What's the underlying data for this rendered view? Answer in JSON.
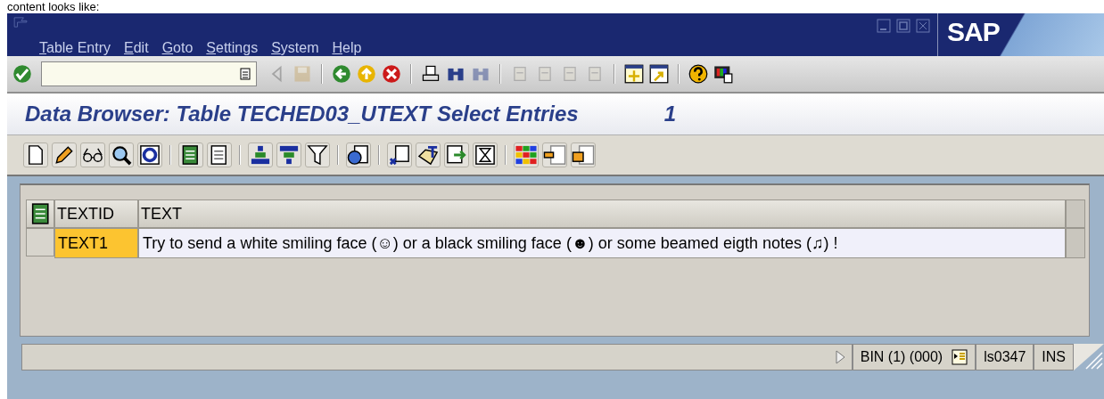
{
  "caption": "content looks like:",
  "window": {
    "logo": "SAP"
  },
  "menu": [
    {
      "label": "Table Entry"
    },
    {
      "label": "Edit"
    },
    {
      "label": "Goto"
    },
    {
      "label": "Settings"
    },
    {
      "label": "System"
    },
    {
      "label": "Help"
    }
  ],
  "system_toolbar": {
    "buttons": [
      {
        "kind": "enter",
        "disabled": false
      },
      {
        "kind": "field"
      },
      {
        "kind": "triangle",
        "disabled": true
      },
      {
        "kind": "save",
        "disabled": true
      },
      {
        "kind": "sep"
      },
      {
        "kind": "back",
        "disabled": false
      },
      {
        "kind": "exit",
        "disabled": false
      },
      {
        "kind": "cancel",
        "disabled": false
      },
      {
        "kind": "sep"
      },
      {
        "kind": "print",
        "disabled": false
      },
      {
        "kind": "find",
        "disabled": false
      },
      {
        "kind": "find",
        "disabled": true
      },
      {
        "kind": "sep"
      },
      {
        "kind": "page",
        "disabled": true
      },
      {
        "kind": "page",
        "disabled": true
      },
      {
        "kind": "page",
        "disabled": true
      },
      {
        "kind": "page",
        "disabled": true
      },
      {
        "kind": "sep"
      },
      {
        "kind": "session",
        "disabled": false
      },
      {
        "kind": "shortcut",
        "disabled": false
      },
      {
        "kind": "sep"
      },
      {
        "kind": "help",
        "disabled": false
      },
      {
        "kind": "layout",
        "disabled": false
      }
    ]
  },
  "screen_title": {
    "text": "Data Browser: Table TECHED03_UTEXT Select Entries",
    "count": "1"
  },
  "app_toolbar": [
    {
      "kind": "new"
    },
    {
      "kind": "pencil"
    },
    {
      "kind": "glasses"
    },
    {
      "kind": "magnifier"
    },
    {
      "kind": "refresh"
    },
    {
      "kind": "sep"
    },
    {
      "kind": "select"
    },
    {
      "kind": "deselect"
    },
    {
      "kind": "sep"
    },
    {
      "kind": "sort-up"
    },
    {
      "kind": "sort-down"
    },
    {
      "kind": "filter"
    },
    {
      "kind": "sep"
    },
    {
      "kind": "details"
    },
    {
      "kind": "sep"
    },
    {
      "kind": "spreadsheet"
    },
    {
      "kind": "text"
    },
    {
      "kind": "export"
    },
    {
      "kind": "hourglass"
    },
    {
      "kind": "sep"
    },
    {
      "kind": "grid"
    },
    {
      "kind": "column"
    },
    {
      "kind": "layout-save"
    }
  ],
  "table": {
    "columns": [
      "TEXTID",
      "TEXT"
    ],
    "rows": [
      {
        "cells": [
          "TEXT1",
          "Try to send a white smiling face (☺) or a black smiling face (☻) or some beamed eigth notes (♫) !"
        ],
        "selected": false
      }
    ]
  },
  "status_bar": {
    "system": "BIN (1) (000)",
    "server": "ls0347",
    "mode": "INS"
  }
}
